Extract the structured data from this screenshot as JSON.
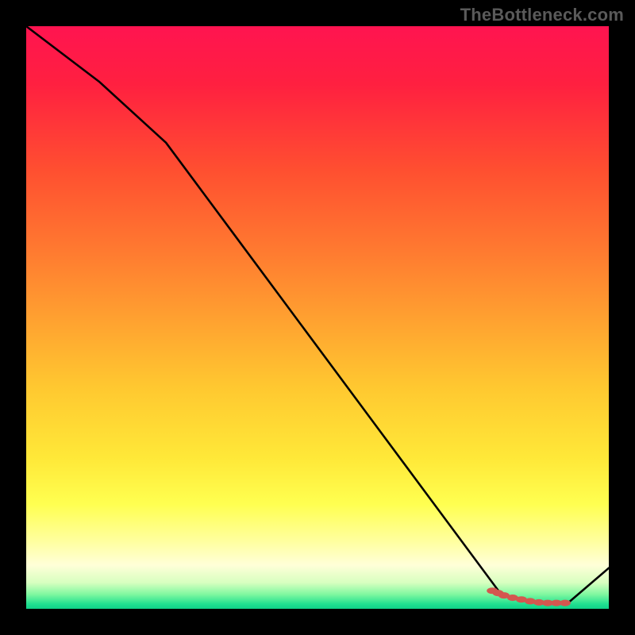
{
  "watermark": "TheBottleneck.com",
  "gradient_stops": [
    {
      "offset": 0.0,
      "color": "#ff1450"
    },
    {
      "offset": 0.1,
      "color": "#ff2040"
    },
    {
      "offset": 0.25,
      "color": "#ff5030"
    },
    {
      "offset": 0.38,
      "color": "#ff7830"
    },
    {
      "offset": 0.5,
      "color": "#ffa030"
    },
    {
      "offset": 0.62,
      "color": "#ffc830"
    },
    {
      "offset": 0.74,
      "color": "#ffe838"
    },
    {
      "offset": 0.82,
      "color": "#ffff50"
    },
    {
      "offset": 0.885,
      "color": "#ffffa0"
    },
    {
      "offset": 0.925,
      "color": "#ffffd8"
    },
    {
      "offset": 0.955,
      "color": "#d8ffc0"
    },
    {
      "offset": 0.975,
      "color": "#80f8a0"
    },
    {
      "offset": 0.992,
      "color": "#20e090"
    },
    {
      "offset": 1.0,
      "color": "#10d088"
    }
  ],
  "chart_data": {
    "type": "line",
    "title": "",
    "xlabel": "",
    "ylabel": "",
    "xlim": [
      0,
      100
    ],
    "ylim": [
      0,
      100
    ],
    "series": [
      {
        "name": "curve",
        "x": [
          0.0,
          12.5,
          24.0,
          35.5,
          47.0,
          58.5,
          70.0,
          81.5,
          88.0,
          93.0,
          100.0
        ],
        "y": [
          100.0,
          90.5,
          80.0,
          64.5,
          49.0,
          33.5,
          18.0,
          2.5,
          1.0,
          1.0,
          7.0
        ]
      }
    ],
    "marker_points": {
      "name": "highlight",
      "color": "#d4574f",
      "x": [
        80.0,
        81.0,
        82.0,
        83.5,
        85.0,
        86.5,
        88.0,
        89.5,
        91.0,
        92.5
      ],
      "y": [
        3.1,
        2.7,
        2.3,
        1.9,
        1.6,
        1.3,
        1.1,
        1.0,
        1.0,
        1.0
      ]
    }
  }
}
